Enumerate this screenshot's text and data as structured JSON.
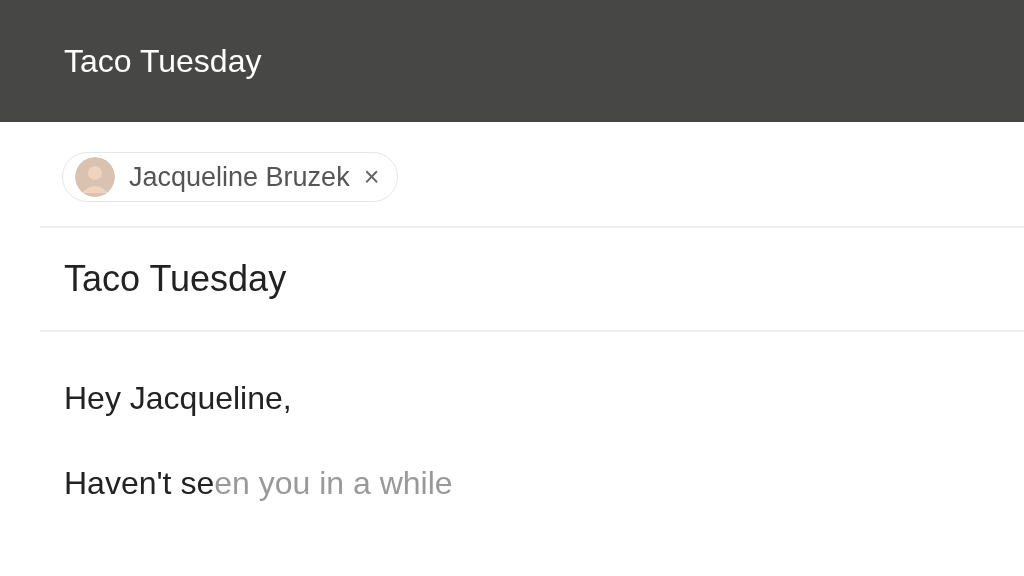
{
  "window": {
    "title": "Taco Tuesday"
  },
  "recipients": [
    {
      "name": "Jacqueline Bruzek",
      "remove": "×"
    }
  ],
  "subject": "Taco Tuesday",
  "body": [
    {
      "text": "Hey Jacqueline,"
    },
    {
      "text": "Haven't se",
      "suggestion": "en you in a while"
    }
  ]
}
